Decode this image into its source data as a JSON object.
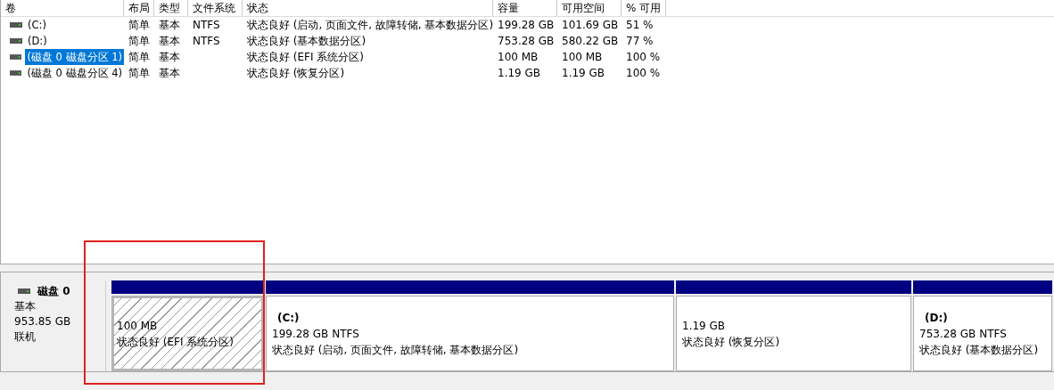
{
  "volume_table": {
    "columns": [
      "卷",
      "布局",
      "类型",
      "文件系统",
      "状态",
      "容量",
      "可用空间",
      "% 可用"
    ],
    "rows": [
      {
        "volume": "(C:)",
        "layout": "简单",
        "type": "基本",
        "filesystem": "NTFS",
        "status": "状态良好 (启动, 页面文件, 故障转储, 基本数据分区)",
        "capacity": "199.28 GB",
        "free": "101.69 GB",
        "percent_free": "51 %",
        "selected": false
      },
      {
        "volume": "(D:)",
        "layout": "简单",
        "type": "基本",
        "filesystem": "NTFS",
        "status": "状态良好 (基本数据分区)",
        "capacity": "753.28 GB",
        "free": "580.22 GB",
        "percent_free": "77 %",
        "selected": false
      },
      {
        "volume": "(磁盘 0 磁盘分区 1)",
        "layout": "简单",
        "type": "基本",
        "status": "状态良好 (EFI 系统分区)",
        "capacity": "100 MB",
        "free": "100 MB",
        "percent_free": "100 %",
        "selected": true
      },
      {
        "volume": "(磁盘 0 磁盘分区 4)",
        "layout": "简单",
        "type": "基本",
        "status": "状态良好 (恢复分区)",
        "capacity": "1.19 GB",
        "free": "1.19 GB",
        "percent_free": "100 %",
        "selected": false
      }
    ]
  },
  "disk": {
    "name": "磁盘 0",
    "type": "基本",
    "size": "953.85 GB",
    "state": "联机",
    "partitions": [
      {
        "size": "100 MB",
        "status": "状态良好 (EFI 系统分区)",
        "selected": true,
        "highlighted": true
      },
      {
        "label": "(C:)",
        "size": "199.28 GB NTFS",
        "status": "状态良好 (启动, 页面文件, 故障转储, 基本数据分区)",
        "selected": false,
        "highlighted": false
      },
      {
        "size": "1.19 GB",
        "status": "状态良好 (恢复分区)",
        "selected": false,
        "highlighted": false
      },
      {
        "label": "(D:)",
        "size": "753.28 GB NTFS",
        "status": "状态良好 (基本数据分区)",
        "selected": false,
        "highlighted": false
      }
    ]
  }
}
